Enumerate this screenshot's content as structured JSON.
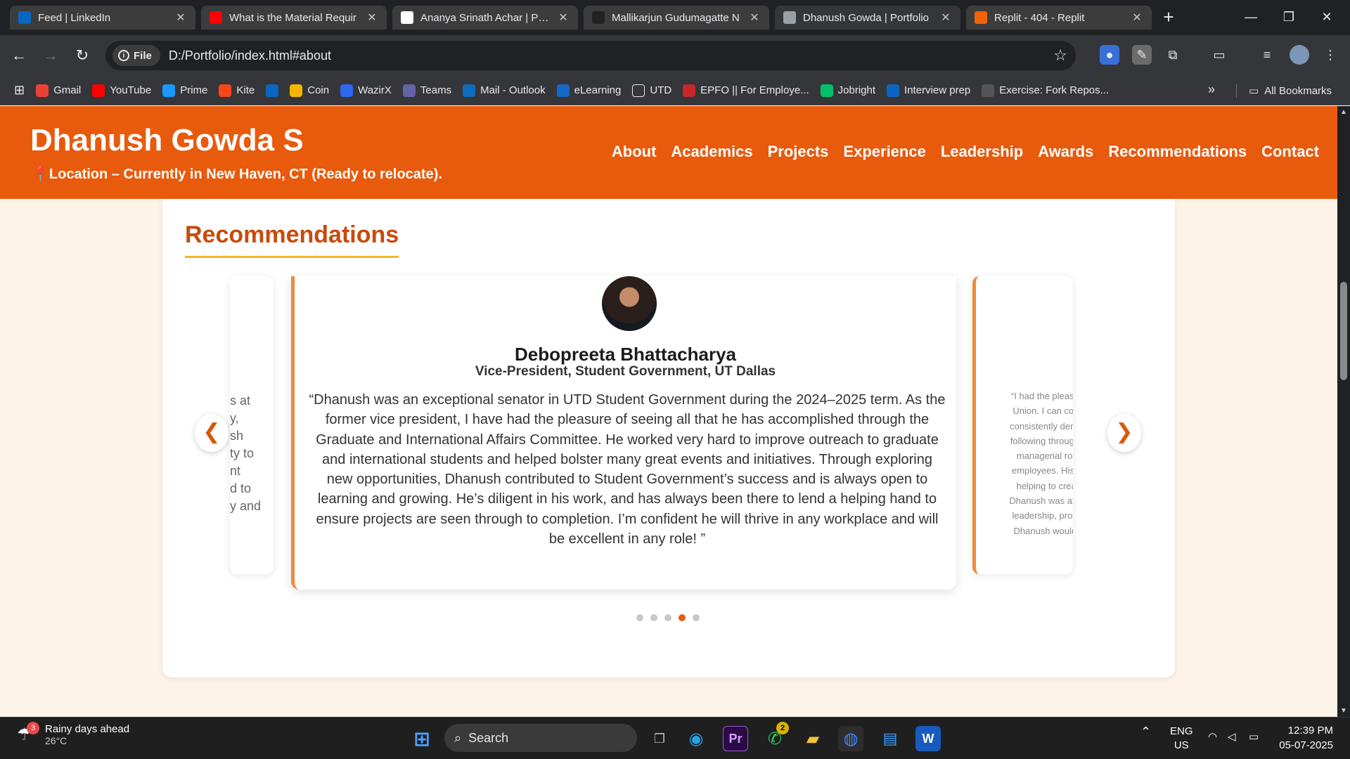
{
  "browser": {
    "tabs": [
      {
        "title": "Feed | LinkedIn",
        "icon": "linkedin-icon",
        "color": "#0a66c2",
        "active": false
      },
      {
        "title": "What is the Material Requir",
        "icon": "youtube-icon",
        "color": "#ff0000",
        "active": false
      },
      {
        "title": "Ananya Srinath Achar | Port",
        "icon": "page-icon",
        "color": "#ffffff",
        "active": false
      },
      {
        "title": "Mallikarjun Gudumagatte N",
        "icon": "lock-icon",
        "color": "#222222",
        "active": false
      },
      {
        "title": "Dhanush Gowda | Portfolio",
        "icon": "globe-icon",
        "color": "#9aa0a6",
        "active": true
      },
      {
        "title": "Replit - 404 - Replit",
        "icon": "replit-icon",
        "color": "#f26207",
        "active": false
      }
    ],
    "address": {
      "chip_label": "File",
      "url": "D:/Portfolio/index.html#about"
    },
    "bookmarks": [
      {
        "label": "Gmail",
        "icon": "gmail-icon",
        "color": "#ea4335"
      },
      {
        "label": "YouTube",
        "icon": "youtube-icon",
        "color": "#ff0000"
      },
      {
        "label": "Prime",
        "icon": "prime-icon",
        "color": "#1a98ff"
      },
      {
        "label": "Kite",
        "icon": "kite-icon",
        "color": "#f6461a"
      },
      {
        "label": "",
        "icon": "linkedin-icon",
        "color": "#0a66c2"
      },
      {
        "label": "Coin",
        "icon": "coin-icon",
        "color": "#f5b400"
      },
      {
        "label": "WazirX",
        "icon": "wazirx-icon",
        "color": "#3067f0"
      },
      {
        "label": "Teams",
        "icon": "teams-icon",
        "color": "#6264a7"
      },
      {
        "label": "Mail - Outlook",
        "icon": "outlook-icon",
        "color": "#0f6cbd"
      },
      {
        "label": "eLearning",
        "icon": "elearning-icon",
        "color": "#1668c7"
      },
      {
        "label": "UTD",
        "icon": "folder-icon",
        "color": "#35363a"
      },
      {
        "label": "EPFO || For Employe...",
        "icon": "epfo-icon",
        "color": "#c62828"
      },
      {
        "label": "Jobright",
        "icon": "jobright-icon",
        "color": "#00c16a"
      },
      {
        "label": "Interview prep",
        "icon": "linkedin-icon",
        "color": "#0a66c2"
      },
      {
        "label": "Exercise: Fork Repos...",
        "icon": "github-icon",
        "color": "#555555"
      }
    ],
    "all_bookmarks_label": "All Bookmarks"
  },
  "site": {
    "name": "Dhanush Gowda S",
    "location": "📍Location – Currently in New Haven, CT (Ready to relocate).",
    "nav": [
      "About",
      "Academics",
      "Projects",
      "Experience",
      "Leadership",
      "Awards",
      "Recommendations",
      "Contact"
    ],
    "accent": "#e85a0c"
  },
  "recommendations": {
    "title": "Recommendations",
    "prev_label": "❮",
    "next_label": "❯",
    "left_partial": "s at\ny,\nsh\nty to\nnt\nd to\ny and",
    "right_partial": "“I had the pleasure of su\nUnion. I can confidently\nconsistently demonstrate\nfollowing through with ex\nmanagerial role, actin\nemployees. His calm, fri\nhelping to create a po\nDhanush was also a lead\nleadership, professional\nDhanush would be a fa",
    "current": {
      "name": "Debopreeta Bhattacharya",
      "role": "Vice-President, Student Government, UT Dallas",
      "quote": "“Dhanush was an exceptional senator in UTD Student Government during the 2024–2025 term. As the former vice president, I have had the pleasure of seeing all that he has accomplished through the Graduate and International Affairs Committee. He worked very hard to improve outreach to graduate and international students and helped bolster many great events and initiatives. Through exploring new opportunities, Dhanush contributed to Student Government’s success and is always open to learning and growing. He’s diligent in his work, and has always been there to lend a helping hand to ensure projects are seen through to completion. I’m confident he will thrive in any workplace and will be excellent in any role! ”"
    },
    "dots": 5,
    "active_dot": 4
  },
  "taskbar": {
    "weather": {
      "text": "Rainy days ahead",
      "temp": "26°C",
      "badge": "3"
    },
    "search_label": "Search",
    "whatsapp_badge": "2",
    "lang": {
      "l1": "ENG",
      "l2": "US"
    },
    "time": "12:39 PM",
    "date": "05-07-2025"
  }
}
